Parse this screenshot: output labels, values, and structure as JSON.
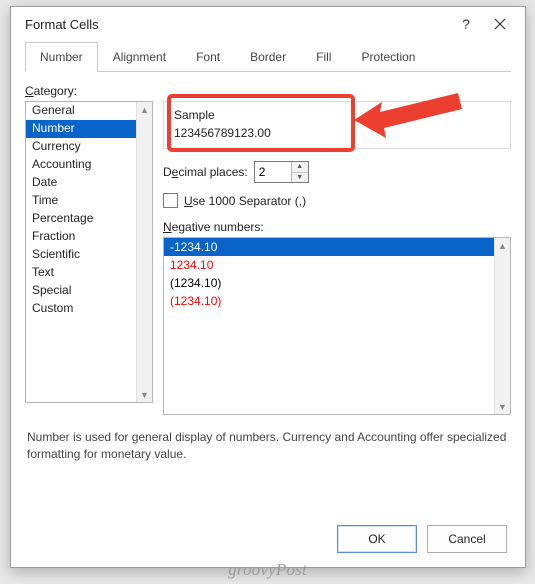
{
  "dialog": {
    "title": "Format Cells"
  },
  "tabs": {
    "number": "Number",
    "alignment": "Alignment",
    "font": "Font",
    "border": "Border",
    "fill": "Fill",
    "protection": "Protection"
  },
  "category": {
    "label": "Category:",
    "items": [
      "General",
      "Number",
      "Currency",
      "Accounting",
      "Date",
      "Time",
      "Percentage",
      "Fraction",
      "Scientific",
      "Text",
      "Special",
      "Custom"
    ],
    "selected_index": 1
  },
  "sample": {
    "label": "Sample",
    "value": "123456789123.00"
  },
  "decimal": {
    "label_pre": "D",
    "label_u": "e",
    "label_post": "cimal places:",
    "value": "2"
  },
  "separator": {
    "label_pre": "",
    "label_u": "U",
    "label_post": "se 1000 Separator (,)",
    "checked": false
  },
  "negative": {
    "label_pre": "",
    "label_u": "N",
    "label_post": "egative numbers:",
    "items": [
      {
        "text": "-1234.10",
        "color": "#000000",
        "selected": true
      },
      {
        "text": "1234.10",
        "color": "#ff0000",
        "selected": false
      },
      {
        "text": "(1234.10)",
        "color": "#000000",
        "selected": false
      },
      {
        "text": "(1234.10)",
        "color": "#ff0000",
        "selected": false
      }
    ]
  },
  "description": "Number is used for general display of numbers.  Currency and Accounting offer specialized formatting for monetary value.",
  "buttons": {
    "ok": "OK",
    "cancel": "Cancel"
  },
  "watermark": "groovyPost",
  "annotation": {
    "color": "#ec3f2f"
  }
}
